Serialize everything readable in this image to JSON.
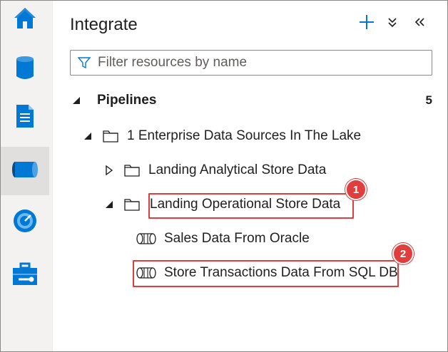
{
  "rail": {
    "items": [
      {
        "name": "home-icon",
        "active": false
      },
      {
        "name": "data-icon",
        "active": false
      },
      {
        "name": "develop-icon",
        "active": false
      },
      {
        "name": "integrate-icon",
        "active": true
      },
      {
        "name": "monitor-icon",
        "active": false
      },
      {
        "name": "manage-icon",
        "active": false
      }
    ]
  },
  "header": {
    "title": "Integrate",
    "add_icon": "plus-icon",
    "expand_icon": "double-chevron-down-icon",
    "collapse_icon": "double-chevron-left-icon"
  },
  "filter": {
    "placeholder": "Filter resources by name",
    "icon": "filter-icon"
  },
  "pipelines": {
    "label": "Pipelines",
    "count": "5"
  },
  "tree": {
    "folder_root": "1 Enterprise Data Sources In The Lake",
    "folder_analytical": "Landing Analytical Store Data",
    "folder_operational": "Landing Operational Store Data",
    "pipeline_sales": "Sales Data From Oracle",
    "pipeline_store": "Store Transactions Data From SQL DB"
  },
  "callouts": {
    "one": "1",
    "two": "2"
  },
  "colors": {
    "accent": "#0078d4",
    "callout": "#e03d3d",
    "rail_bg": "#f3f2f1"
  }
}
